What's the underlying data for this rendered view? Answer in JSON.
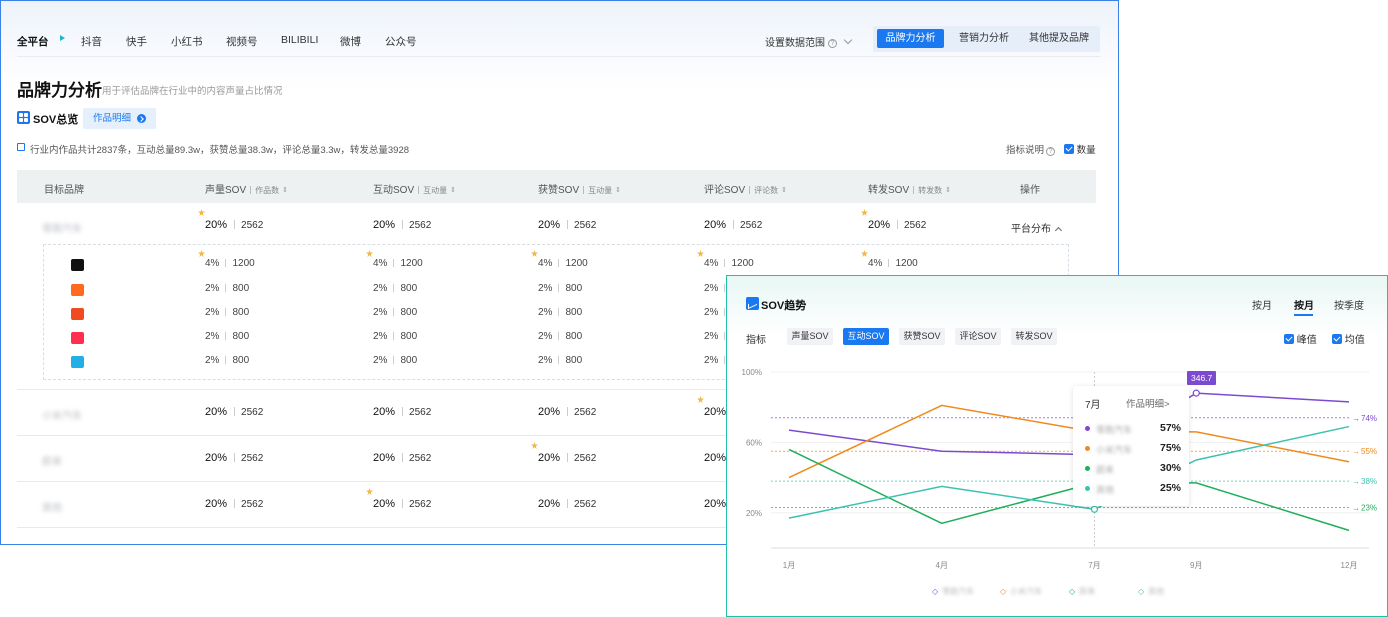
{
  "nav": {
    "platforms": [
      "全平台",
      "抖音",
      "快手",
      "小红书",
      "视频号",
      "BILIBILI",
      "微博",
      "公众号"
    ],
    "range_label": "设置数据范围",
    "tabs": [
      "品牌力分析",
      "营销力分析",
      "其他提及品牌"
    ]
  },
  "page": {
    "title": "品牌力分析",
    "subtitle": "用于评估品牌在行业中的内容声量占比情况"
  },
  "sov_overview": {
    "title": "SOV总览",
    "detail_button": "作品明细",
    "summary": "行业内作品共计2837条，互动总量89.3w，获赞总量38.3w，评论总量3.3w，转发总量3928",
    "metric_note": "指标说明",
    "count_checkbox": "数量"
  },
  "table": {
    "headers": {
      "brand": "目标品牌",
      "volume": "声量SOV",
      "volume_sub": "作品数",
      "interaction": "互动SOV",
      "interaction_sub": "互动量",
      "likes": "获赞SOV",
      "likes_sub": "互动量",
      "comments": "评论SOV",
      "comments_sub": "评论数",
      "shares": "转发SOV",
      "shares_sub": "转发数",
      "action": "操作"
    },
    "platform_dist": "平台分布",
    "rows": [
      {
        "brand": "零跑汽车",
        "pct": "20%",
        "num": "2562"
      },
      {
        "brand": "小米汽车",
        "pct": "20%",
        "num": "2562"
      },
      {
        "brand": "蔚来",
        "pct": "20%",
        "num": "2562"
      },
      {
        "brand": "其他",
        "pct": "20%",
        "num": "2562"
      }
    ],
    "sub_rows": [
      {
        "platform": "douyin-icon",
        "color": "#111111",
        "pct": "4%",
        "num": "1200"
      },
      {
        "platform": "kuaishou-icon",
        "color": "#ff6a1f",
        "pct": "2%",
        "num": "800"
      },
      {
        "platform": "weibo-icon",
        "color": "#f04a23",
        "pct": "2%",
        "num": "800"
      },
      {
        "platform": "xiaohongshu-icon",
        "color": "#ff2e4f",
        "pct": "2%",
        "num": "800"
      },
      {
        "platform": "bilibili-icon",
        "color": "#23aee5",
        "pct": "2%",
        "num": "800"
      }
    ]
  },
  "trend": {
    "title": "SOV趋势",
    "period_tabs": [
      "按月",
      "按月",
      "按季度"
    ],
    "metric_label": "指标",
    "metrics": [
      "声量SOV",
      "互动SOV",
      "获赞SOV",
      "评论SOV",
      "转发SOV"
    ],
    "peak_checkbox": "峰值",
    "avg_checkbox": "均值",
    "tooltip": {
      "month": "7月",
      "link": "作品明细>",
      "items": [
        {
          "name": "零跑汽车",
          "value": "57%",
          "color": "#7c4ad0"
        },
        {
          "name": "小米汽车",
          "value": "75%",
          "color": "#f08a1e"
        },
        {
          "name": "蔚来",
          "value": "30%",
          "color": "#1fae5a"
        },
        {
          "name": "其他",
          "value": "25%",
          "color": "#3cc2b0"
        }
      ]
    },
    "peak_value": "346.7"
  },
  "chart_data": {
    "type": "line",
    "x": [
      "1月",
      "2月",
      "3月",
      "4月",
      "5月",
      "6月",
      "7月",
      "8月",
      "9月",
      "10月",
      "11月",
      "12月"
    ],
    "x_ticks": [
      "1月",
      "4月",
      "7月",
      "9月",
      "12月"
    ],
    "y_ticks": [
      "100%",
      "60%",
      "20%"
    ],
    "ylim": [
      0,
      100
    ],
    "series": [
      {
        "name": "零跑汽车",
        "color": "#7c4ad0",
        "points": [
          [
            1,
            67
          ],
          [
            4,
            55
          ],
          [
            7,
            53
          ],
          [
            9,
            88
          ],
          [
            12,
            83
          ]
        ],
        "avg": "74%",
        "avg_value": 74
      },
      {
        "name": "小米汽车",
        "color": "#f08a1e",
        "points": [
          [
            1,
            40
          ],
          [
            4,
            81
          ],
          [
            7,
            66
          ],
          [
            9,
            66
          ],
          [
            12,
            49
          ]
        ],
        "avg": "55%",
        "avg_value": 55
      },
      {
        "name": "蔚来",
        "color": "#1fae5a",
        "points": [
          [
            1,
            56
          ],
          [
            4,
            14
          ],
          [
            7,
            37
          ],
          [
            9,
            37
          ],
          [
            12,
            10
          ]
        ],
        "avg": "23%",
        "avg_value": 23
      },
      {
        "name": "其他",
        "color": "#3cc2b0",
        "points": [
          [
            1,
            17
          ],
          [
            4,
            35
          ],
          [
            7,
            22
          ],
          [
            9,
            50
          ],
          [
            12,
            69
          ]
        ],
        "avg": "38%",
        "avg_value": 38
      }
    ]
  }
}
